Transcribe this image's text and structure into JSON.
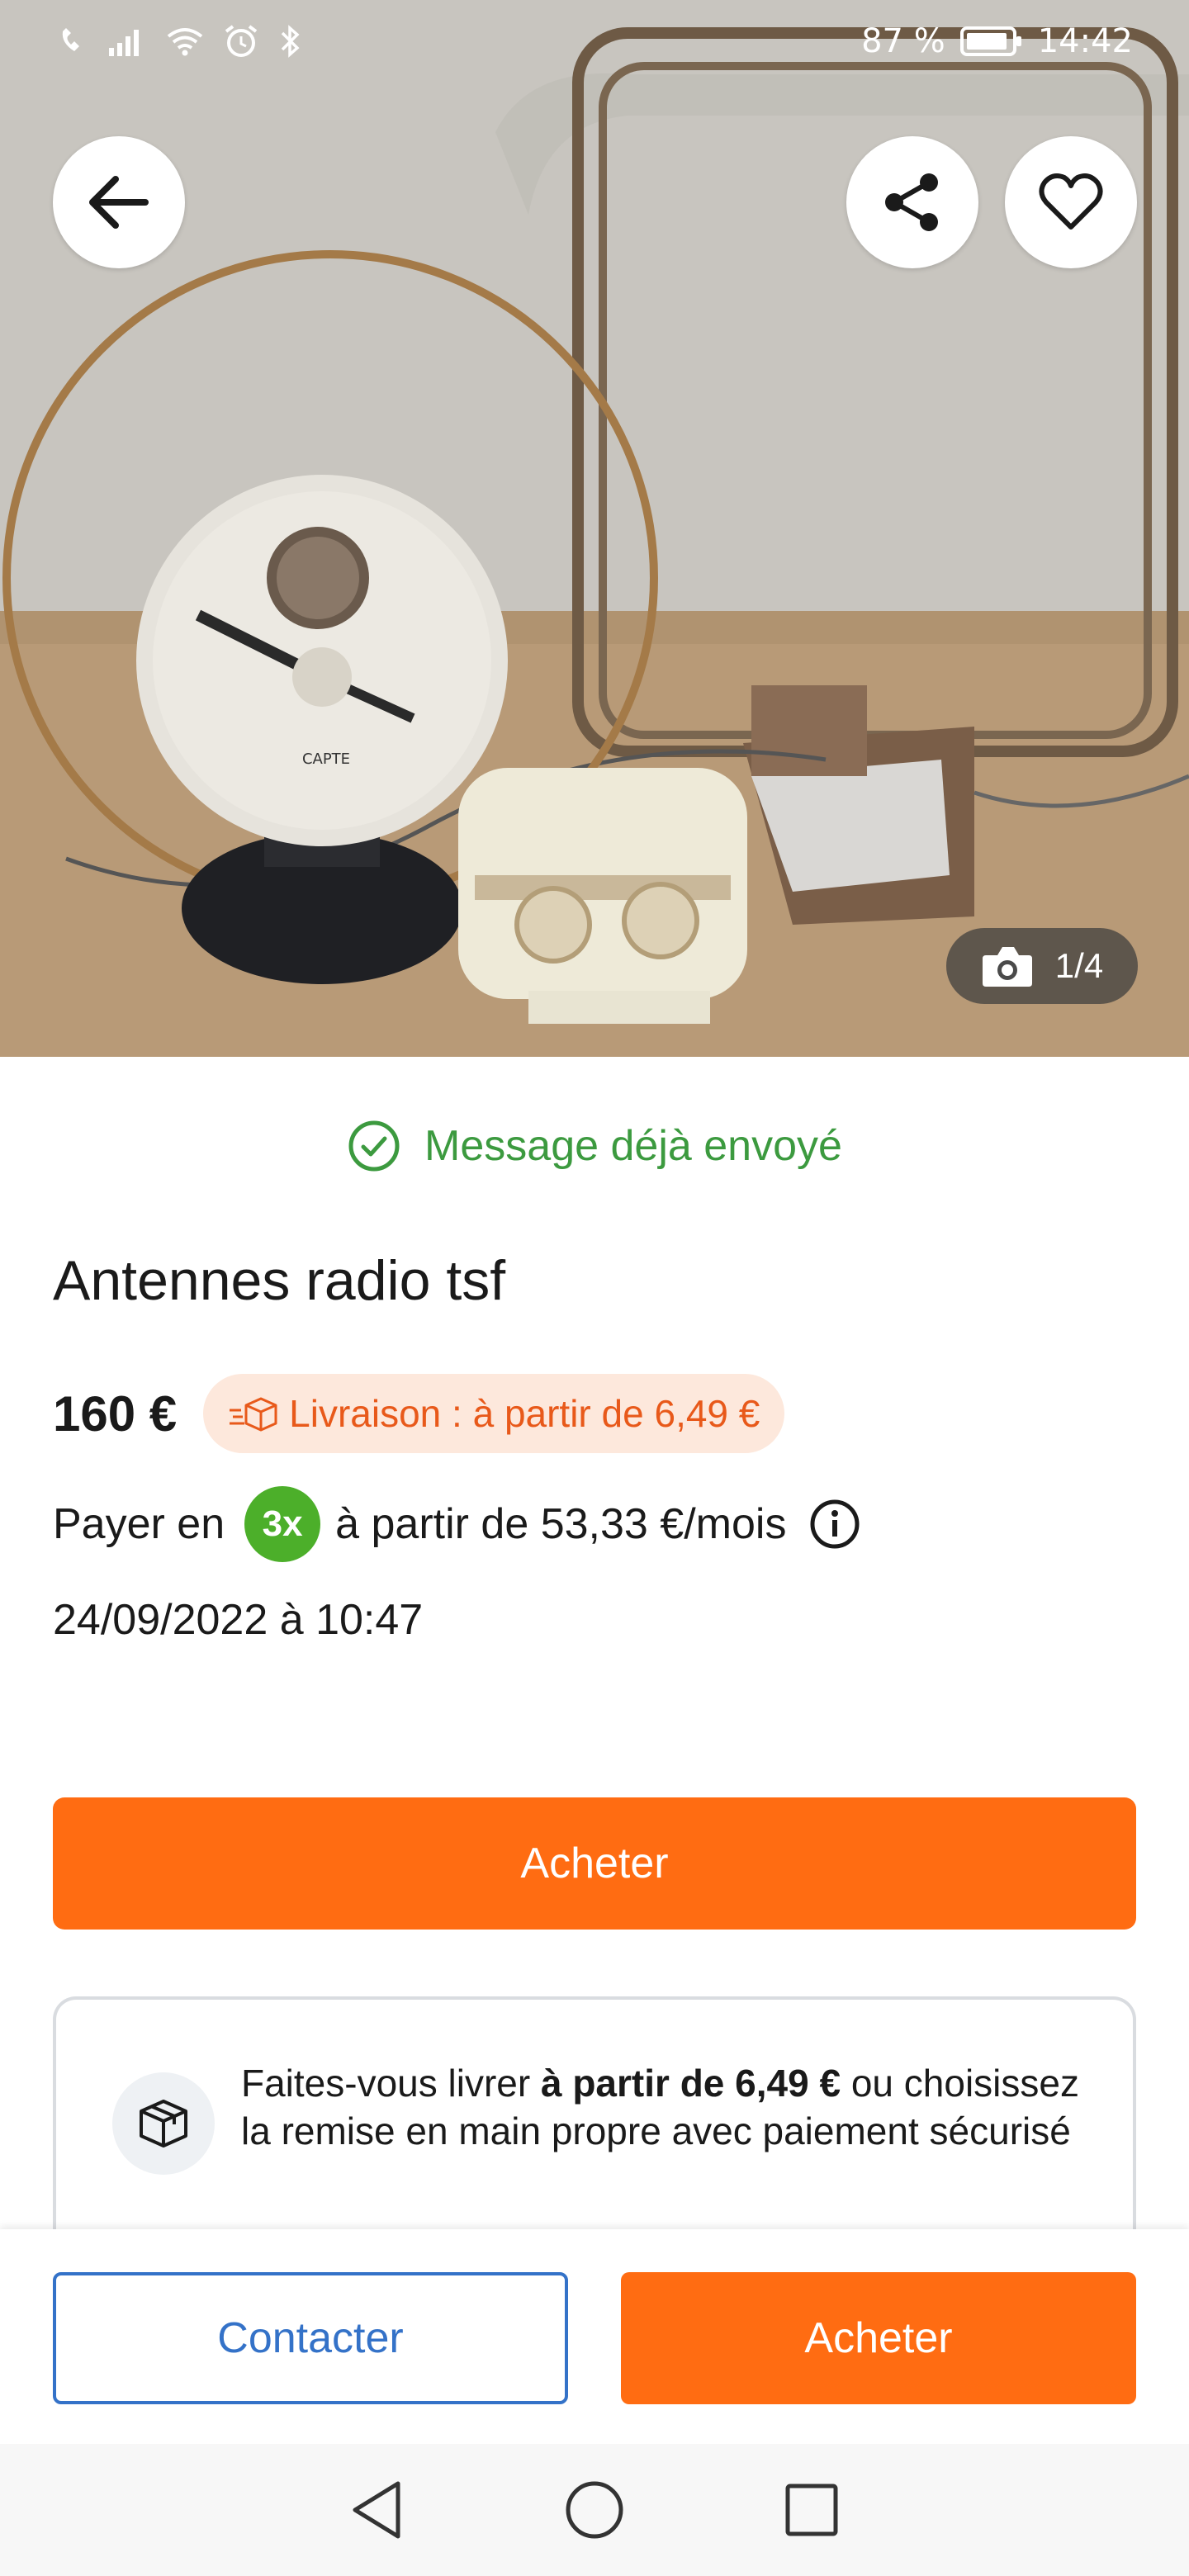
{
  "status_bar": {
    "battery": "87 %",
    "time": "14:42",
    "icons": [
      "call-wifi-icon",
      "signal-icon",
      "wifi-icon",
      "alarm-icon",
      "bluetooth-icon",
      "battery-icon"
    ]
  },
  "header": {
    "icons": [
      "back-arrow-icon",
      "share-icon",
      "heart-icon"
    ]
  },
  "photo": {
    "counter": "1/4",
    "counter_icon": "camera-icon"
  },
  "listing": {
    "message_status": "Message déjà envoyé",
    "title": "Antennes radio tsf",
    "price": "160 €",
    "delivery_badge": "Livraison : à partir de 6,49 €",
    "pay_prefix": "Payer en",
    "pay_badge": "3x",
    "pay_suffix": "à partir de 53,33 €/mois",
    "date": "24/09/2022 à 10:47"
  },
  "buy_button_label": "Acheter",
  "delivery_card": {
    "text_before": "Faites-vous livrer ",
    "text_bold": "à partir de 6,49 €",
    "text_after": " ou choisissez la remise en main propre avec paiement sécurisé"
  },
  "action_bar": {
    "contact_label": "Contacter",
    "buy_label": "Acheter"
  },
  "nav_bar": {
    "icons": [
      "nav-back-icon",
      "nav-home-icon",
      "nav-recents-icon"
    ]
  },
  "colors": {
    "accent_orange": "#ff6c12",
    "success_green": "#3c9a3f",
    "link_blue": "#3472c8",
    "badge_bg": "#fde8dc",
    "pay_badge_green": "#4caf2a"
  }
}
